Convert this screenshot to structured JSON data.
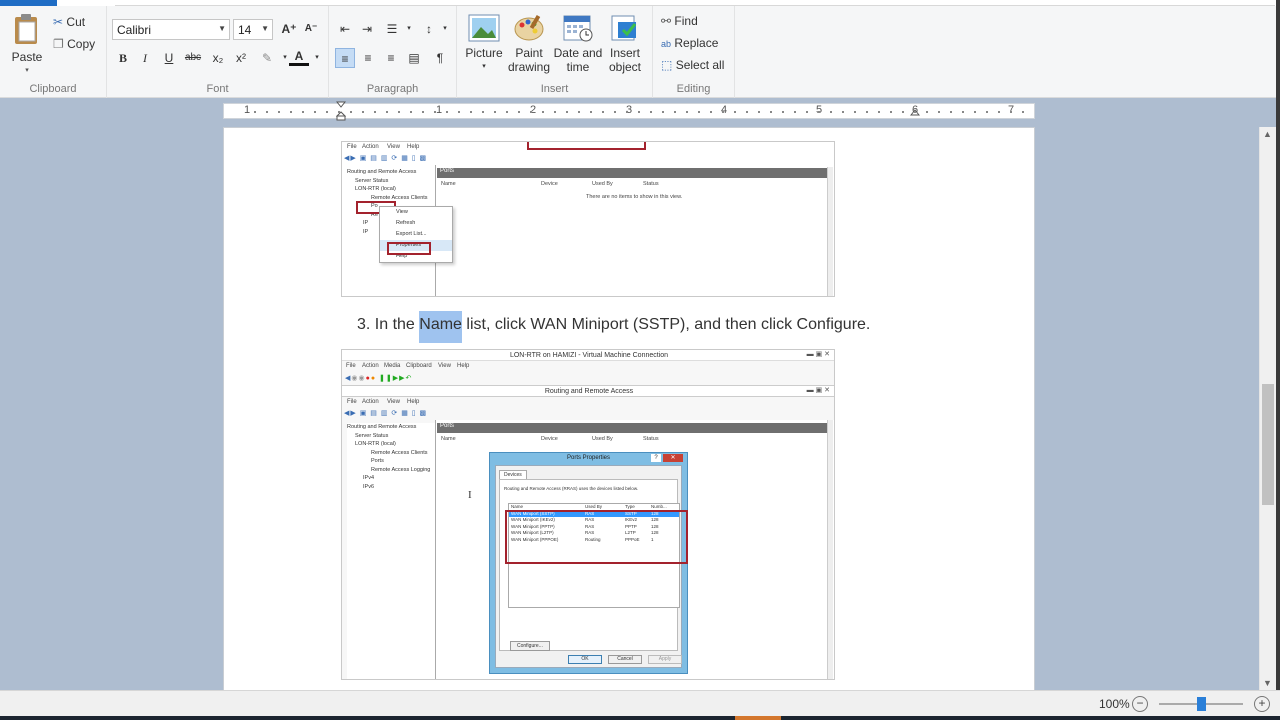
{
  "ribbon": {
    "clipboard": {
      "group_label": "Clipboard",
      "paste": "Paste",
      "cut": "Cut",
      "copy": "Copy"
    },
    "font": {
      "group_label": "Font",
      "family": "Calibri",
      "size": "14"
    },
    "paragraph": {
      "group_label": "Paragraph"
    },
    "insert": {
      "group_label": "Insert",
      "picture": "Picture",
      "paint_drawing_1": "Paint",
      "paint_drawing_2": "drawing",
      "date_time_1": "Date and",
      "date_time_2": "time",
      "insert_object_1": "Insert",
      "insert_object_2": "object"
    },
    "editing": {
      "group_label": "Editing",
      "find": "Find",
      "replace": "Replace",
      "select_all": "Select all"
    }
  },
  "ruler": {
    "numbers": [
      "1",
      "1",
      "2",
      "3",
      "4",
      "5",
      "6",
      "7"
    ]
  },
  "document": {
    "step_text_before": "3. In the ",
    "step_text_highlight": "Name",
    "step_text_after": " list, click WAN Miniport (SSTP), and then click Configure."
  },
  "screenshot1": {
    "menu": [
      "File",
      "Action",
      "View",
      "Help"
    ],
    "tree": [
      "Routing and Remote Access",
      "Server Status",
      "LON-RTR (local)",
      "Remote Access Clients",
      "Po",
      "Re",
      "IP",
      "IP"
    ],
    "pane_header": "Ports",
    "columns": [
      "Name",
      "Device",
      "Used By",
      "Status"
    ],
    "empty_text": "There are no items to show in this view.",
    "context_menu": [
      "View",
      "Refresh",
      "Export List...",
      "Properties",
      "Help"
    ]
  },
  "screenshot2": {
    "vm_title": "LON-RTR on HAMIZI - Virtual Machine Connection",
    "vm_menu": [
      "File",
      "Action",
      "Media",
      "Clipboard",
      "View",
      "Help"
    ],
    "app_title": "Routing and Remote Access",
    "menu": [
      "File",
      "Action",
      "View",
      "Help"
    ],
    "tree": [
      "Routing and Remote Access",
      "Server Status",
      "LON-RTR (local)",
      "Remote Access Clients",
      "Ports",
      "Remote Access Logging",
      "IPv4",
      "IPv6"
    ],
    "pane_header": "Ports",
    "columns": [
      "Name",
      "Device",
      "Used By",
      "Status"
    ],
    "dialog": {
      "title": "Ports Properties",
      "tab": "Devices",
      "description": "Routing and Remote Access (RRAS) uses the devices listed below.",
      "columns": [
        "Name",
        "Used By",
        "Type",
        "Numb..."
      ],
      "rows": [
        [
          "WAN Miniport (SSTP)",
          "RAS",
          "SSTP",
          "128"
        ],
        [
          "WAN Miniport (IKEv2)",
          "RAS",
          "IKEv2",
          "128"
        ],
        [
          "WAN Miniport (PPTP)",
          "RAS",
          "PPTP",
          "128"
        ],
        [
          "WAN Miniport (L2TP)",
          "RAS",
          "L2TP",
          "128"
        ],
        [
          "WAN Miniport (PPPOE)",
          "Routing",
          "PPPoE",
          "1"
        ]
      ],
      "configure": "Configure...",
      "ok": "OK",
      "cancel": "Cancel",
      "apply": "Apply"
    }
  },
  "status": {
    "zoom": "100%",
    "zoom_level": 0.5
  }
}
